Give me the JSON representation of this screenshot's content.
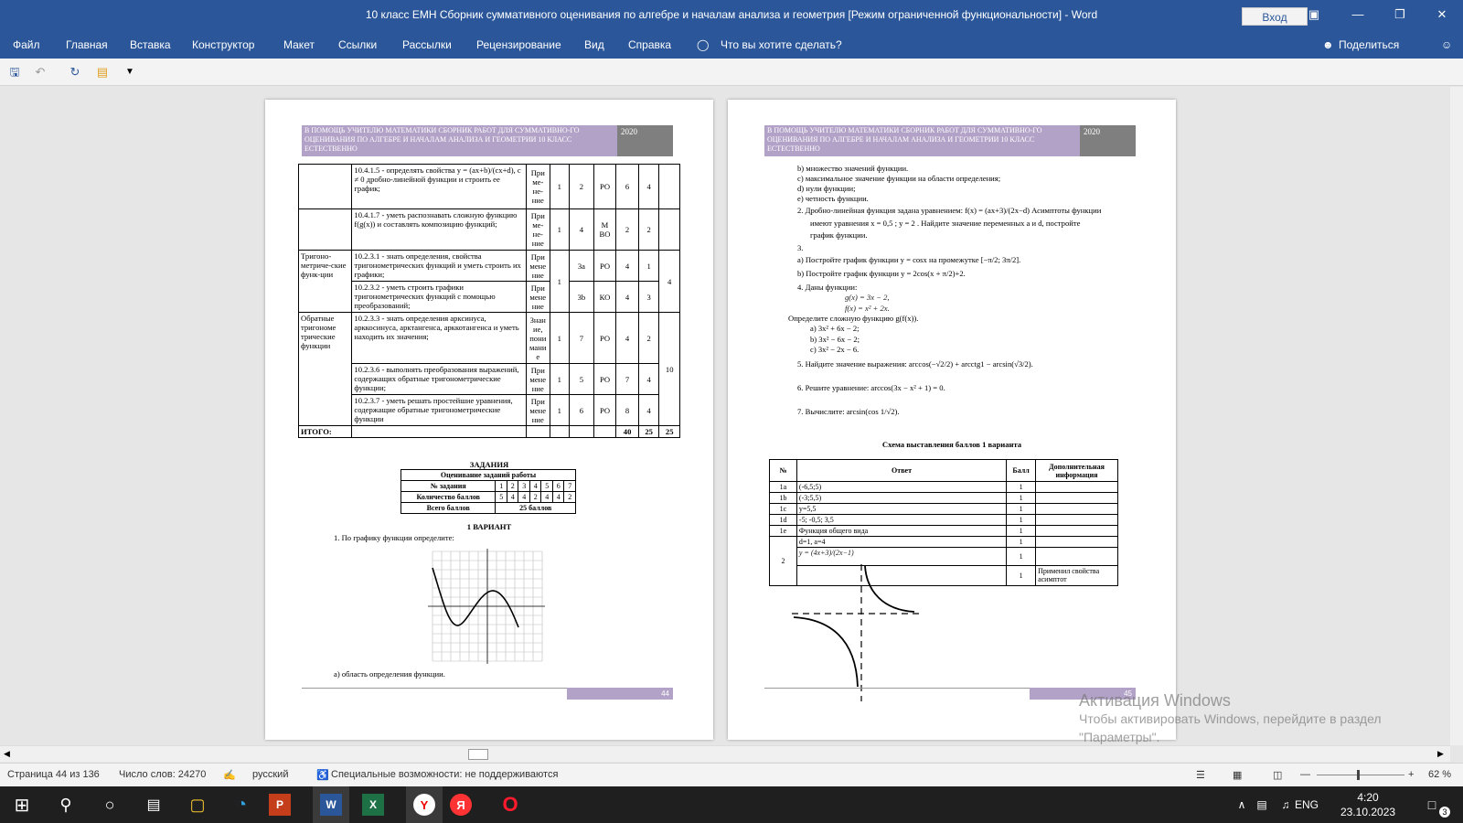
{
  "window": {
    "title": "10 класс ЕМН Сборник суммативного оценивания по алгебре и началам анализа и геометрия [Режим ограниченной функциональности]  -  Word",
    "signin": "Вход"
  },
  "menu": {
    "tabs": [
      "Файл",
      "Главная",
      "Вставка",
      "Конструктор",
      "Макет",
      "Ссылки",
      "Рассылки",
      "Рецензирование",
      "Вид",
      "Справка"
    ],
    "tell_me": "Что вы хотите сделать?",
    "share": "Поделиться"
  },
  "pages": {
    "left": {
      "header": "В ПОМОЩЬ УЧИТЕЛЮ МАТЕМАТИКИ СБОРНИК РАБОТ ДЛЯ СУММАТИВНО-ГО ОЦЕНИВАНИЯ  ПО  АЛГЕБРЕ И НАЧАЛАМ АНАЛИЗА  И ГЕОМЕТРИИ  10 КЛАСС ЕСТЕСТВЕННО",
      "year": "2020",
      "page_number": "44",
      "spec_rows": [
        {
          "topic": "",
          "goal": "10.4.1.5 - определять свойства y = (ax+b)/(cx+d), c ≠ 0 дробно-линейной функции и строить ее график;",
          "level": "При ме- не- ние",
          "hours": "1",
          "task": "2",
          "form": "РО",
          "score": "6",
          "total": "4"
        },
        {
          "topic": "",
          "goal": "10.4.1.7 - уметь распознавать сложную функцию f(g(x)) и составлять композицию функций;",
          "level": "При ме- не- ние",
          "hours": "1",
          "task": "4",
          "form": "М ВО",
          "score": "2",
          "total": "2"
        },
        {
          "topic": "Тригоно-метриче-ские функ-ции",
          "goal": "10.2.3.1 - знать определения, свойства тригонометрических функций и уметь строить их графики;",
          "level": "При мене ние",
          "hours": "1",
          "task": "3a",
          "form": "РО",
          "score": "4",
          "total": "1"
        },
        {
          "topic": "",
          "goal": "10.2.3.2 - уметь строить графики тригонометрических функций с помощью преобразований;",
          "level": "При мене ние",
          "hours": "",
          "task": "3b",
          "form": "КО",
          "score": "4",
          "total": "3"
        },
        {
          "topic": "Обратные тригономе трические функции",
          "goal": "10.2.3.3 - знать определения арксинуса, арккосинуса, арктангенса, арккотангенса и уметь находить их значения;",
          "level": "Знан ие, пони мани е",
          "hours": "1",
          "task": "7",
          "form": "РО",
          "score": "4",
          "total": "2"
        },
        {
          "topic": "",
          "goal": "10.2.3.6 - выполнять преобразования выражений, содержащих обратные тригонометрические функции;",
          "level": "При мене ние",
          "hours": "1",
          "task": "5",
          "form": "РО",
          "score": "7",
          "total": "4"
        },
        {
          "topic": "",
          "goal": "10.2.3.7 - уметь решать простейшие уравнения, содержащие обратные тригонометрические функции",
          "level": "При мене ние",
          "hours": "1",
          "task": "6",
          "form": "РО",
          "score": "8",
          "total": "4"
        }
      ],
      "group_totals": [
        "4",
        "10"
      ],
      "total_row": {
        "label": "ИТОГО:",
        "a": "40",
        "b": "25",
        "c": "25"
      },
      "tasks_title": "ЗАДАНИЯ",
      "grading": {
        "caption": "Оценивание  заданий работы",
        "row1_label": "№ задания",
        "row1": [
          "1",
          "2",
          "3",
          "4",
          "5",
          "6",
          "7"
        ],
        "row2_label": "Количество баллов",
        "row2": [
          "5",
          "4",
          "4",
          "2",
          "4",
          "4",
          "2"
        ],
        "row3_label": "Всего баллов",
        "row3_value": "25  баллов"
      },
      "variant": "1    ВАРИАНТ",
      "q1": "1.   По графику функции определите:",
      "q1a": "а) область определения функции."
    },
    "right": {
      "header": "В ПОМОЩЬ УЧИТЕЛЮ МАТЕМАТИКИ СБОРНИК РАБОТ ДЛЯ СУММАТИВНО-ГО ОЦЕНИВАНИЯ  ПО  АЛГЕБРЕ И НАЧАЛАМ АНАЛИЗА  И ГЕОМЕТРИИ  10 КЛАСС ЕСТЕСТВЕННО",
      "year": "2020",
      "page_number": "45",
      "lines": [
        "b) множество значений функции.",
        "c) максимальное значение функции на области определения;",
        "d) нули функции;",
        "e) четность функции."
      ],
      "q2": "2.    Дробно-линейная функция задана уравнением:  f(x) = (ax+3)/(2x−d)   Асимптоты функции",
      "q2b": "имеют уравнения  x = 0,5 ;  y = 2 . Найдите значение переменных a и d, постройте",
      "q2c": "график функции.",
      "q3": "3.",
      "q3a": "a) Постройте график функции y = cosx на промежутке [−π/2; 3π/2].",
      "q3b": "b) Постройте график функции y = 2cos(x + π/2)+2.",
      "q4": "4.    Даны функции:",
      "q4g": "g(x) = 3x − 2,",
      "q4f": "f(x) = x² + 2x.",
      "q4t": "Определите сложную функцию g(f(x)).",
      "q4a": "a)   3x² + 6x − 2;",
      "q4b": "b)   3x² − 6x − 2;",
      "q4c": "c)   3x² − 2x − 6.",
      "q5": "5.    Найдите значение выражения: arccos(−√2/2) + arcctg1 − arcsin(√3/2).",
      "q6": "6.    Решите уравнение: arccos(3x − x² + 1) = 0.",
      "q7": "7.    Вычислите: arcsin(cos 1/√2).",
      "scheme_title": "Схема выставления баллов 1 варианта",
      "scheme_headers": [
        "№",
        "Ответ",
        "Балл",
        "Дополнительная информация"
      ],
      "scheme_rows": [
        {
          "n": "1a",
          "answer": "(-6,5;5)",
          "score": "1",
          "info": ""
        },
        {
          "n": "1b",
          "answer": "(-3;5,5)",
          "score": "1",
          "info": ""
        },
        {
          "n": "1c",
          "answer": "y=5,5",
          "score": "1",
          "info": ""
        },
        {
          "n": "1d",
          "answer": "-5; -0,5; 3,5",
          "score": "1",
          "info": ""
        },
        {
          "n": "1e",
          "answer": "Функция общего вида",
          "score": "1",
          "info": ""
        }
      ],
      "scheme_row2": {
        "n": "2",
        "a1": "d=1, a=4",
        "s1": "1",
        "a2": "y = (4x+3)/(2x−1)",
        "s2": "1",
        "s3": "1",
        "info3": "Применил свойства асимптот"
      }
    }
  },
  "watermark": {
    "line1": "Активация Windows",
    "line2": "Чтобы активировать Windows, перейдите в раздел",
    "line3": "\"Параметры\"."
  },
  "status": {
    "page": "Страница 44 из 136",
    "words": "Число слов: 24270",
    "language": "русский",
    "accessibility": "Специальные возможности: не поддерживаются",
    "zoom": "62 %"
  },
  "taskbar": {
    "lang": "ENG",
    "time": "4:20",
    "date": "23.10.2023",
    "notifications": "3"
  }
}
